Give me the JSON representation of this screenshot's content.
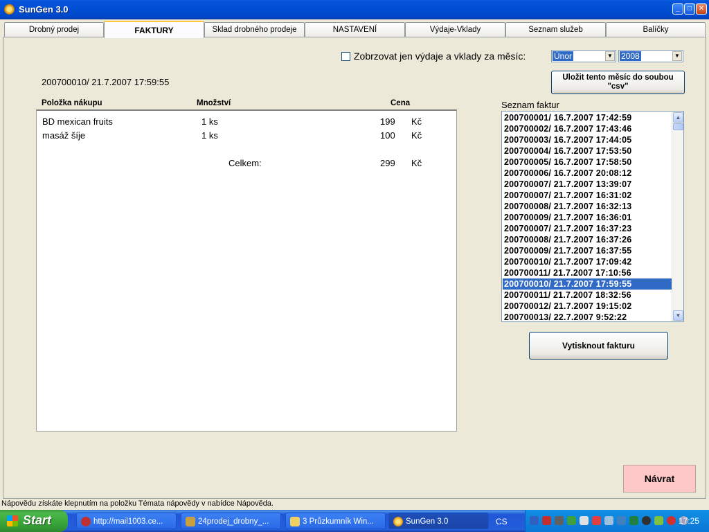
{
  "window": {
    "title": "SunGen 3.0"
  },
  "tabs": [
    {
      "label": "Drobný prodej"
    },
    {
      "label": "FAKTURY"
    },
    {
      "label": "Sklad drobného prodeje"
    },
    {
      "label": "NASTAVENÍ"
    },
    {
      "label": "Výdaje-Vklady"
    },
    {
      "label": "Seznam služeb"
    },
    {
      "label": "Balíčky"
    }
  ],
  "filter": {
    "checkbox_label": "Zobrzovat jen výdaje a vklady za měsíc:",
    "month": "Únor",
    "year": "2008"
  },
  "save_csv_button": "Uložit tento měsíc do soubou \"csv\"",
  "invoice": {
    "title": "200700010/ 21.7.2007 17:59:55",
    "headers": {
      "item": "Položka nákupu",
      "qty": "Množství",
      "price": "Cena"
    },
    "items": [
      {
        "name": "BD mexican fruits",
        "qty": "1 ks",
        "price": "199",
        "currency": "Kč"
      },
      {
        "name": "masáž šíje",
        "qty": "1 ks",
        "price": "100",
        "currency": "Kč"
      }
    ],
    "total_label": "Celkem:",
    "total_value": "299",
    "total_currency": "Kč"
  },
  "invoice_list": {
    "label": "Seznam faktur",
    "items": [
      "200700001/ 16.7.2007 17:42:59",
      "200700002/ 16.7.2007 17:43:46",
      "200700003/ 16.7.2007 17:44:05",
      "200700004/ 16.7.2007 17:53:50",
      "200700005/ 16.7.2007 17:58:50",
      "200700006/ 16.7.2007 20:08:12",
      "200700007/ 21.7.2007 13:39:07",
      "200700007/ 21.7.2007 16:31:02",
      "200700008/ 21.7.2007 16:32:13",
      "200700009/ 21.7.2007 16:36:01",
      "200700007/ 21.7.2007 16:37:23",
      "200700008/ 21.7.2007 16:37:26",
      "200700009/ 21.7.2007 16:37:55",
      "200700010/ 21.7.2007 17:09:42",
      "200700011/ 21.7.2007 17:10:56",
      "200700010/ 21.7.2007 17:59:55",
      "200700011/ 21.7.2007 18:32:56",
      "200700012/ 21.7.2007 19:15:02",
      "200700013/ 22.7.2007 9:52:22"
    ],
    "selected_index": 15
  },
  "print_button": "Vytisknout fakturu",
  "back_button": "Návrat",
  "status_text": "Nápovědu získáte klepnutím na položku Témata nápovědy v nabídce Nápověda.",
  "taskbar": {
    "start": "Start",
    "tasks": [
      {
        "label": "http://mail1003.ce..."
      },
      {
        "label": "24prodej_drobny_..."
      },
      {
        "label": "3 Průzkumník Win..."
      },
      {
        "label": "SunGen 3.0"
      }
    ],
    "language": "CS",
    "clock": "17:25"
  },
  "colors": {
    "selection": "#316AC5",
    "back_button_bg": "#FFC8C8",
    "titlebar": "#0050D6"
  }
}
